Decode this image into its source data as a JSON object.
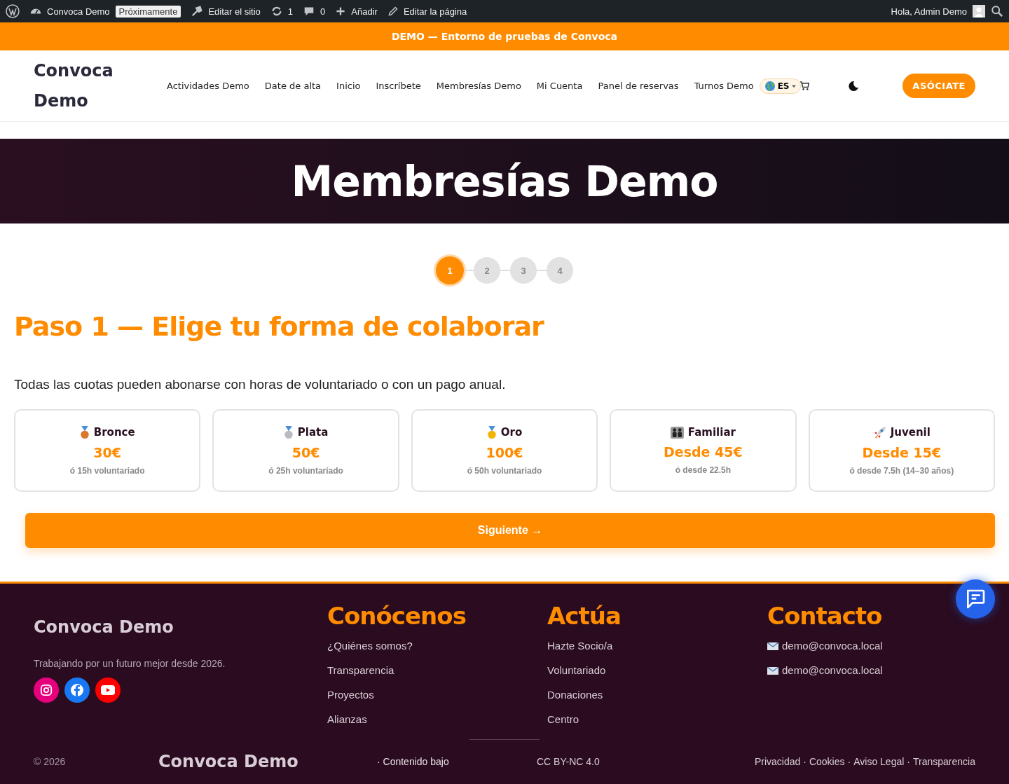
{
  "admin_bar": {
    "site": "Convoca Demo",
    "badge": "Próximamente",
    "items": [
      {
        "kind": "edit-site",
        "label": "Editar el sitio"
      },
      {
        "kind": "updates",
        "label": "1"
      },
      {
        "kind": "comments",
        "label": "0"
      },
      {
        "kind": "add",
        "label": "Añadir"
      },
      {
        "kind": "edit-page",
        "label": "Editar la página"
      }
    ],
    "greeting": "Hola, Admin Demo"
  },
  "banner": "DEMO — Entorno de pruebas de Convoca",
  "header": {
    "logo_lines": [
      "Convoca",
      "Demo"
    ],
    "nav": [
      {
        "label": "Actividades Demo",
        "selected": false
      },
      {
        "label": "Date de alta",
        "selected": false
      },
      {
        "label": "Inicio",
        "selected": false
      },
      {
        "label": "Inscríbete",
        "selected": false
      },
      {
        "label": "Membresías Demo",
        "selected": false
      },
      {
        "label": "Mi Cuenta",
        "selected": false
      },
      {
        "label": "Panel de reservas",
        "selected": false
      },
      {
        "label": "Turnos Demo",
        "selected": false
      }
    ],
    "language": "ES",
    "cta": "ASÓCIATE"
  },
  "hero_title": "Membresías Demo",
  "steps": [
    {
      "label": "1",
      "selected": true
    },
    {
      "label": "2",
      "selected": false
    },
    {
      "label": "3",
      "selected": false
    },
    {
      "label": "4",
      "selected": false
    }
  ],
  "step_title": "Paso 1 — Elige tu forma de colaborar",
  "intro": "Todas las cuotas pueden abonarse con horas de voluntariado o con un pago anual.",
  "tiers": [
    {
      "kind": "medal",
      "color": "#d9772b",
      "name": "Bronce",
      "price": "30€",
      "alt": "ó 15h voluntariado"
    },
    {
      "kind": "medal",
      "color": "#b8bcc2",
      "name": "Plata",
      "price": "50€",
      "alt": "ó 25h voluntariado"
    },
    {
      "kind": "medal",
      "color": "#f2b400",
      "name": "Oro",
      "price": "100€",
      "alt": "ó 50h voluntariado"
    },
    {
      "kind": "family",
      "name": "Familiar",
      "price": "Desde 45€",
      "alt": "ó desde 22.5h"
    },
    {
      "kind": "rocket",
      "name": "Juvenil",
      "price": "Desde 15€",
      "alt": "ó desde 7.5h (14–30 años)"
    }
  ],
  "next_button": "Siguiente →",
  "footer": {
    "brand": "Convoca Demo",
    "tagline": "Trabajando por un futuro mejor desde 2026.",
    "social": [
      {
        "kind": "instagram",
        "color": "#e6007e"
      },
      {
        "kind": "facebook",
        "color": "#1877f2"
      },
      {
        "kind": "youtube",
        "color": "#ff0000"
      }
    ],
    "columns": [
      {
        "title": "Conócenos",
        "links": [
          {
            "kind": "link",
            "label": "¿Quiénes somos?"
          },
          {
            "kind": "link",
            "label": "Transparencia"
          },
          {
            "kind": "link",
            "label": "Proyectos"
          },
          {
            "kind": "link",
            "label": "Alianzas"
          }
        ]
      },
      {
        "title": "Actúa",
        "links": [
          {
            "kind": "link",
            "label": "Hazte Socio/a"
          },
          {
            "kind": "link",
            "label": "Voluntariado"
          },
          {
            "kind": "link",
            "label": "Donaciones"
          },
          {
            "kind": "link",
            "label": "Centro"
          }
        ]
      },
      {
        "title": "Contacto",
        "links": [
          {
            "kind": "email",
            "label": "demo@convoca.local"
          },
          {
            "kind": "email",
            "label": "demo@convoca.local"
          }
        ]
      }
    ],
    "copyright": "© 2026",
    "bottom_brand": "Convoca Demo",
    "content_note": "· Contenido bajo",
    "license": "CC BY-NC 4.0",
    "legal_links": [
      "Privacidad",
      "Cookies",
      "Aviso Legal",
      "Transparencia"
    ],
    "separator": "·"
  }
}
